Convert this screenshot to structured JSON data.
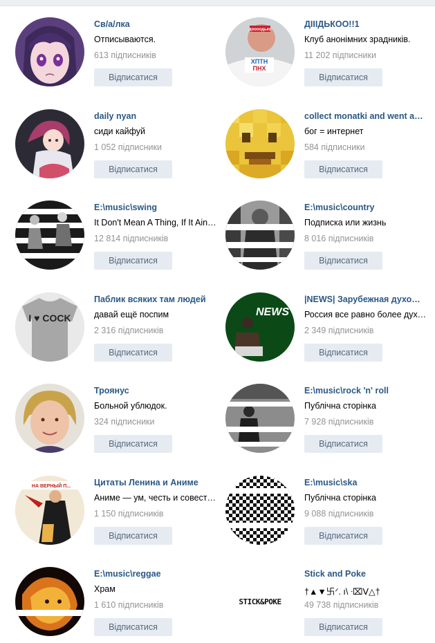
{
  "groups": [
    {
      "name": "Св/а/лка",
      "description": "Отписываются.",
      "subscribers": "613 підписників",
      "button": "Відписатися",
      "avatar": "anime-girl-purple-hair"
    },
    {
      "name": "ДІІІДЬКОО!!1",
      "description": "Клуб анонімних зрадників.",
      "subscribers": "11 202 підписники",
      "button": "Відписатися",
      "avatar": "man-with-shirt-photo",
      "avatar_sign": "доооодько"
    },
    {
      "name": "daily nyan",
      "description": "сиди кайфуй",
      "subscribers": "1 052 підписники",
      "button": "Відписатися",
      "avatar": "anime-girl-pink-hair"
    },
    {
      "name": "collect monatki and went away",
      "description": "бог = интернет",
      "subscribers": "584 підписники",
      "button": "Відписатися",
      "avatar": "pixelated-smiley"
    },
    {
      "name": "E:\\music\\swing",
      "description": "It Don't Mean A Thing, If It Ain't Got That Swing",
      "subscribers": "12 814 підписників",
      "button": "Відписатися",
      "avatar": "swing-dancers-striped"
    },
    {
      "name": "E:\\music\\country",
      "description": "Подписка или жизнь",
      "subscribers": "8 016 підписників",
      "button": "Відписатися",
      "avatar": "country-musician-striped"
    },
    {
      "name": "Паблик всяких там людей",
      "description": "давай ещё поспим",
      "subscribers": "2 316 підписників",
      "button": "Відписатися",
      "avatar": "tshirt-print",
      "avatar_sign": "I ♥ COCK"
    },
    {
      "name": "|NEWS| Зарубежная духовность",
      "description": "Россия все равно более духовная",
      "subscribers": "2 349 підписників",
      "button": "Відписатися",
      "avatar": "news-man-green",
      "avatar_sign": "NEWS"
    },
    {
      "name": "Троянус",
      "description": "Больной ублюдок.",
      "subscribers": "324 підписники",
      "button": "Відписатися",
      "avatar": "woman-portrait"
    },
    {
      "name": "E:\\music\\rock 'n' roll",
      "description": "Публічна сторінка",
      "subscribers": "7 928 підписників",
      "button": "Відписатися",
      "avatar": "rock-dancers-striped"
    },
    {
      "name": "Цитаты Ленина и Аниме",
      "description": "Аниме — ум, честь и совесть нашей эпохи",
      "subscribers": "1 150 підписників",
      "button": "Відписатися",
      "avatar": "soviet-poster",
      "avatar_sign": "НА ВЕРНЫЙ П..."
    },
    {
      "name": "E:\\music\\ska",
      "description": "Публічна сторінка",
      "subscribers": "9 088 підписників",
      "button": "Відписатися",
      "avatar": "checkerboard-ska"
    },
    {
      "name": "E:\\music\\reggae",
      "description": "Храм",
      "subscribers": "1 610 підписників",
      "button": "Відписатися",
      "avatar": "lion-fire-striped"
    },
    {
      "name": "Stick and Poke",
      "description": "†▲▼卐ᐟ. ı\\ ᐧ⌧ᐯ△†",
      "subscribers": "49 738 підписників",
      "button": "Відписатися",
      "avatar": "stick-and-poke-logo",
      "avatar_sign": "STICK&POKE"
    }
  ]
}
